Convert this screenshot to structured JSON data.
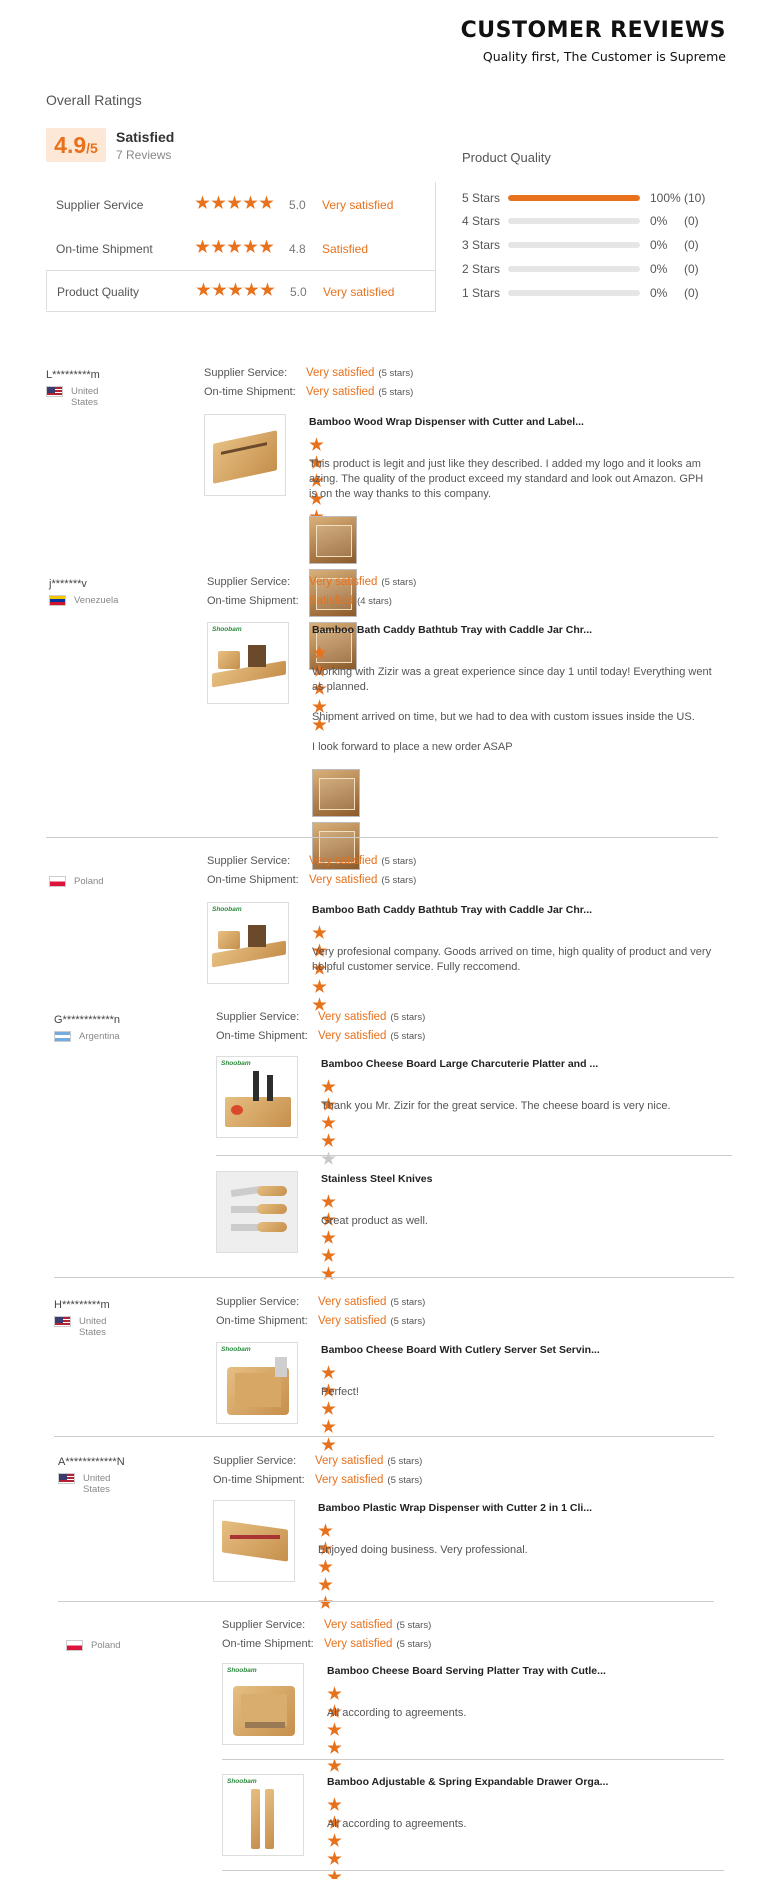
{
  "header": {
    "title": "CUSTOMER REVIEWS",
    "subtitle": "Quality first, The Customer is Supreme"
  },
  "overall": {
    "title": "Overall Ratings",
    "score": "4.9",
    "score_max": "/5",
    "label": "Satisfied",
    "count": "7 Reviews",
    "rows": [
      {
        "label": "Supplier Service",
        "value": "5.0",
        "text": "Very satisfied",
        "stars": 5
      },
      {
        "label": "On-time Shipment",
        "value": "4.8",
        "text": "Satisfied",
        "stars": 5
      },
      {
        "label": "Product Quality",
        "value": "5.0",
        "text": "Very satisfied",
        "stars": 5
      }
    ]
  },
  "product_quality": {
    "title": "Product Quality",
    "rows": [
      {
        "label": "5 Stars",
        "pct": "100%",
        "count": "(10)",
        "fill": 1.0
      },
      {
        "label": "4 Stars",
        "pct": "0%",
        "count": "(0)",
        "fill": 0
      },
      {
        "label": "3 Stars",
        "pct": "0%",
        "count": "(0)",
        "fill": 0
      },
      {
        "label": "2 Stars",
        "pct": "0%",
        "count": "(0)",
        "fill": 0
      },
      {
        "label": "1 Stars",
        "pct": "0%",
        "count": "(0)",
        "fill": 0
      }
    ]
  },
  "labels": {
    "supplier_service": "Supplier Service:",
    "ontime_shipment": "On-time Shipment:"
  },
  "reviews": [
    {
      "user": "L*********m",
      "country": "United States",
      "supplier": "Very satisfied",
      "supplier_stars": "(5 stars)",
      "shipment": "Very satisfied",
      "shipment_stars": "(5 stars)",
      "items": [
        {
          "title": "Bamboo Wood Wrap Dispenser with Cutter and Label...",
          "rating": 5,
          "text": [
            "This product is legit and just like they described.  I added my logo and it looks am",
            "azing.  The quality of the product exceed my standard and look out Amazon.  GPH",
            "is on the way thanks to this company."
          ]
        }
      ]
    },
    {
      "user": "j*******v",
      "country": "Venezuela",
      "supplier": "Very satisfied",
      "supplier_stars": "(5 stars)",
      "shipment": "Satisfied",
      "shipment_stars": "(4 stars)",
      "items": [
        {
          "brand": "Shoobam",
          "title": "Bamboo Bath Caddy Bathtub Tray with Caddle Jar Chr...",
          "rating": 5,
          "text": [
            "Working with Zizir was a great experience since day 1 until today! Everything went",
            "as planned.",
            "",
            "Shipment arrived on time, but we had to dea with custom issues inside the US.",
            "",
            "I look forward to place a new order ASAP"
          ]
        }
      ]
    },
    {
      "user": "",
      "country": "Poland",
      "supplier": "Very satisfied",
      "supplier_stars": "(5 stars)",
      "shipment": "Very satisfied",
      "shipment_stars": "(5 stars)",
      "items": [
        {
          "brand": "Shoobam",
          "title": "Bamboo Bath Caddy Bathtub Tray with Caddle Jar Chr...",
          "rating": 5,
          "text": [
            "Very profesional company. Goods arrived on time, high quality of product and very",
            "helpful customer service. Fully reccomend."
          ]
        }
      ]
    },
    {
      "user": "G************n",
      "country": "Argentina",
      "supplier": "Very satisfied",
      "supplier_stars": "(5 stars)",
      "shipment": "Very satisfied",
      "shipment_stars": "(5 stars)",
      "items": [
        {
          "brand": "Shoobam",
          "title": "Bamboo Cheese Board Large Charcuterie Platter and ...",
          "rating": 4,
          "text": [
            "Thank you Mr. Zizir for the great service. The cheese board is very nice."
          ]
        },
        {
          "title": "Stainless Steel Knives",
          "rating": 5,
          "text": [
            "Great product as well."
          ]
        }
      ]
    },
    {
      "user": "H*********m",
      "country": "United States",
      "supplier": "Very satisfied",
      "supplier_stars": "(5 stars)",
      "shipment": "Very satisfied",
      "shipment_stars": "(5 stars)",
      "items": [
        {
          "brand": "Shoobam",
          "title": "Bamboo Cheese Board With Cutlery Server Set Servin...",
          "rating": 5,
          "text": [
            "Perfect!"
          ]
        }
      ]
    },
    {
      "user": "A************N",
      "country": "United States",
      "supplier": "Very satisfied",
      "supplier_stars": "(5 stars)",
      "shipment": "Very satisfied",
      "shipment_stars": "(5 stars)",
      "items": [
        {
          "title": "Bamboo Plastic Wrap Dispenser with Cutter 2 in 1 Cli...",
          "rating": 5,
          "text": [
            "Enjoyed doing business. Very professional."
          ]
        }
      ]
    },
    {
      "user": "",
      "country": "Poland",
      "supplier": "Very satisfied",
      "supplier_stars": "(5 stars)",
      "shipment": "Very satisfied",
      "shipment_stars": "(5 stars)",
      "items": [
        {
          "brand": "Shoobam",
          "title": "Bamboo Cheese Board Serving Platter Tray with Cutle...",
          "rating": 5,
          "text": [
            "All according to agreements."
          ]
        },
        {
          "brand": "Shoobam",
          "title": "Bamboo Adjustable & Spring Expandable Drawer Orga...",
          "rating": 5,
          "text": [
            "All according to agreements."
          ]
        }
      ]
    }
  ]
}
